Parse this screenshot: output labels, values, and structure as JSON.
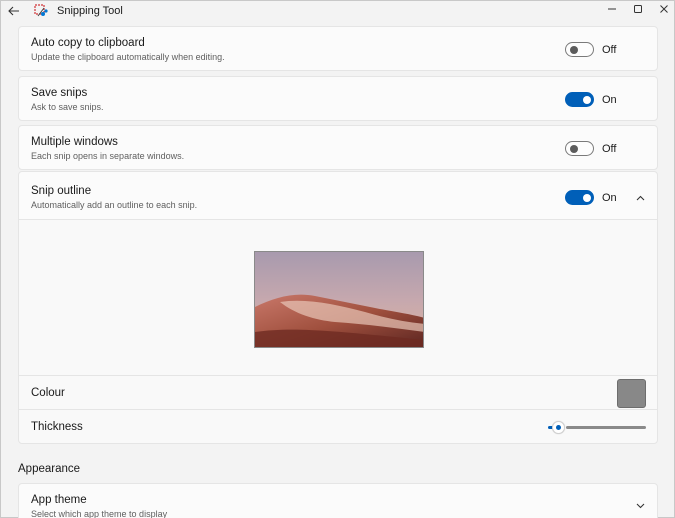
{
  "window": {
    "title": "Snipping Tool",
    "back_icon": "back-arrow-icon",
    "minimize_icon": "minimize-icon",
    "maximize_icon": "maximize-icon",
    "close_icon": "close-icon"
  },
  "settings": {
    "auto_copy": {
      "title": "Auto copy to clipboard",
      "subtitle": "Update the clipboard automatically when editing.",
      "state_label": "Off",
      "enabled": false
    },
    "save_snips": {
      "title": "Save snips",
      "subtitle": "Ask to save snips.",
      "state_label": "On",
      "enabled": true
    },
    "multiple_windows": {
      "title": "Multiple windows",
      "subtitle": "Each snip opens in separate windows.",
      "state_label": "Off",
      "enabled": false
    },
    "snip_outline": {
      "title": "Snip outline",
      "subtitle": "Automatically add an outline to each snip.",
      "state_label": "On",
      "enabled": true,
      "expanded": true,
      "colour_label": "Colour",
      "colour_value": "#888888",
      "thickness_label": "Thickness",
      "thickness_value": 0.1
    }
  },
  "appearance": {
    "heading": "Appearance",
    "app_theme": {
      "title": "App theme",
      "subtitle": "Select which app theme to display"
    }
  },
  "colors": {
    "accent": "#005fb8",
    "background": "#f3f3f3",
    "card": "#fbfbfb"
  }
}
